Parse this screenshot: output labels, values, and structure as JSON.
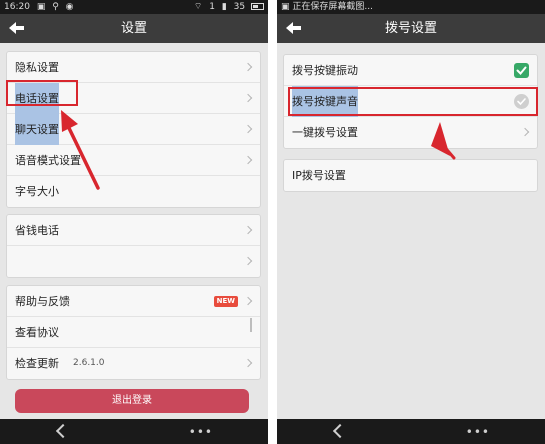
{
  "left_screen": {
    "status": {
      "time": "16:20",
      "signal_text": "1",
      "battery_text": "35"
    },
    "title": "设置",
    "group1": [
      {
        "label": "隐私设置"
      },
      {
        "label": "电话设置"
      },
      {
        "label": "聊天设置"
      },
      {
        "label": "语音模式设置"
      },
      {
        "label": "字号大小"
      }
    ],
    "group2": [
      {
        "label": "省钱电话"
      },
      {
        "label": ""
      }
    ],
    "group3": [
      {
        "label": "帮助与反馈",
        "badge": "NEW"
      },
      {
        "label": "查看协议"
      },
      {
        "label": "检查更新",
        "version": "2.6.1.0"
      }
    ],
    "logout_label": "退出登录"
  },
  "right_screen": {
    "status": {
      "notice": "正在保存屏幕截图..."
    },
    "title": "拨号设置",
    "group1": [
      {
        "label": "拨号按键振动",
        "checked": true
      },
      {
        "label": "拨号按键声音",
        "checked": false
      },
      {
        "label": "一键拨号设置"
      }
    ],
    "group2": [
      {
        "label": "IP拨号设置"
      }
    ]
  },
  "colors": {
    "annotation_red": "#d8262e",
    "check_green": "#37a867",
    "logout_red": "#c9485b",
    "new_badge": "#e84c3d"
  }
}
